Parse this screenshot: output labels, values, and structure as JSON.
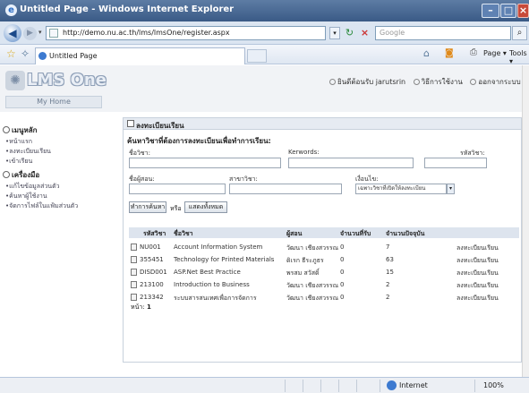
{
  "browser": {
    "title": "Untitled Page - Windows Internet Explorer",
    "url": "http://demo.nu.ac.th/lms/lmsOne/register.aspx",
    "search_placeholder": "Google",
    "tab_label": "Untitled Page",
    "cmd_page": "Page ▾",
    "cmd_tools": "Tools ▾",
    "status_zone": "Internet",
    "status_zoom": "100%"
  },
  "header": {
    "logo": "LMS One",
    "home_tab": "My Home",
    "links": [
      "ยินดีต้อนรับ jarutsrin",
      "วิธีการใช้งาน",
      "ออกจากระบบ"
    ]
  },
  "sidebar": {
    "menu_title": "เมนูหลัก",
    "menu_items": [
      "•หน้าแรก",
      "•ลงทะเบียนเรียน",
      "•เข้าเรียน"
    ],
    "tools_title": "เครื่องมือ",
    "tools_items": [
      "•แก้ไขข้อมูลส่วนตัว",
      "•ค้นหาผู้ใช้งาน",
      "•จัดการไฟล์ในแฟ้มส่วนตัว"
    ]
  },
  "main": {
    "title": "ลงทะเบียนเรียน",
    "subtitle": "ค้นหาวิชาที่ต้องการลงทะเบียนเพื่อทำการเรียน:",
    "labels": {
      "course_name": "ชื่อวิชา:",
      "keywords": "Kerwords:",
      "course_code": "รหัสวิชา:",
      "instructor": "ชื่อผู้สอน:",
      "major": "สาขาวิชา:",
      "condition": "เงื่อนไข:"
    },
    "condition_value": "เฉพาะวิชาที่เปิดให้ลงทะเบียน",
    "search_button": "ทำการค้นหา",
    "or_text": "หรือ",
    "show_all_button": "แสดงทั้งหมด",
    "columns": [
      "รหัสวิชา",
      "ชื่อวิชา",
      "ผู้สอน",
      "จำนวนที่รับ",
      "จำนวนปัจจุบัน"
    ],
    "rows": [
      {
        "code": "NU001",
        "name": "Account Information System",
        "teacher": "วัฒนา เชียงสวรรณ",
        "capacity": "0",
        "current": "7",
        "action": "ลงทะเบียนเรียน"
      },
      {
        "code": "355451",
        "name": "Technology for Printed Materials",
        "teacher": "ดิเรก ธีระภูธร",
        "capacity": "0",
        "current": "63",
        "action": "ลงทะเบียนเรียน"
      },
      {
        "code": "DISD001",
        "name": "ASP.Net Best Practice",
        "teacher": "พรสม สวัสดิ์",
        "capacity": "0",
        "current": "15",
        "action": "ลงทะเบียนเรียน"
      },
      {
        "code": "213100",
        "name": "Introduction to Business",
        "teacher": "วัฒนา เชียงสวรรณ",
        "capacity": "0",
        "current": "2",
        "action": "ลงทะเบียนเรียน"
      },
      {
        "code": "213342",
        "name": "ระบบสารสนเทศเพื่อการจัดการ",
        "teacher": "วัฒนา เชียงสวรรณ",
        "capacity": "0",
        "current": "2",
        "action": "ลงทะเบียนเรียน"
      }
    ],
    "pager_label": "หน้า:",
    "pager_value": "1"
  }
}
